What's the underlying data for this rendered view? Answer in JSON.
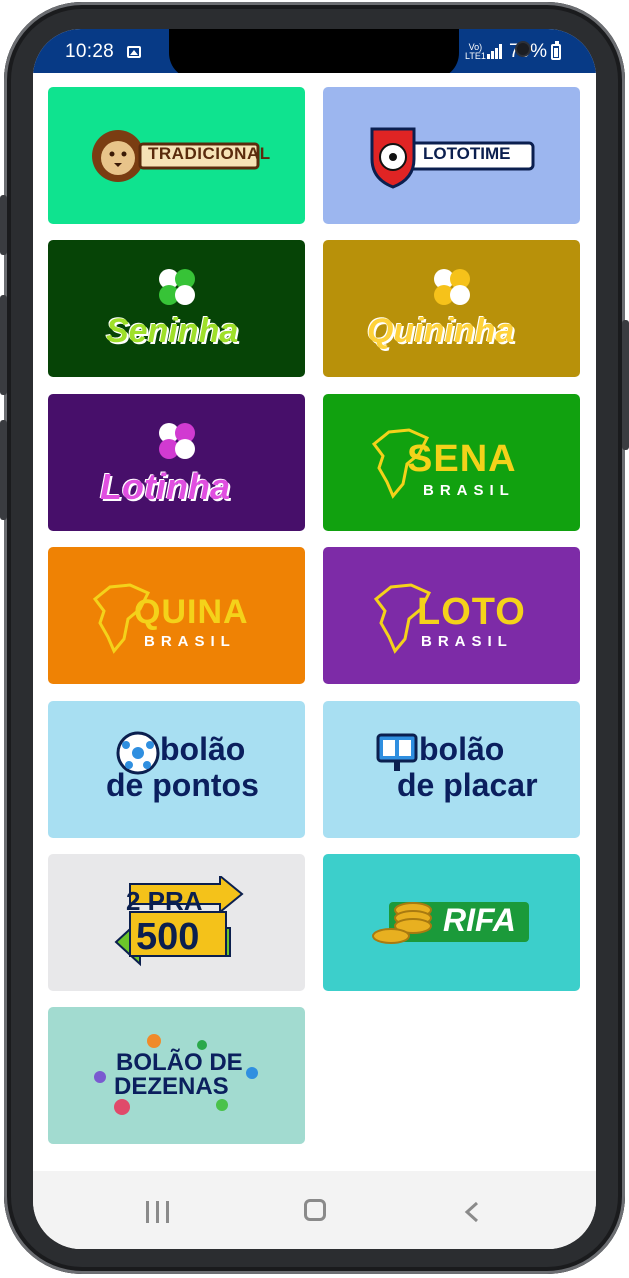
{
  "status_bar": {
    "time": "10:28",
    "network_top": "Vo)",
    "network_bottom": "LTE1",
    "battery_percent": "79%",
    "background": "#073a86"
  },
  "games": [
    {
      "label": "TRADICIONAL",
      "background": "#0fe38f",
      "icon": "lion-icon"
    },
    {
      "label": "LOTOTIME",
      "background": "#9cb6ef",
      "icon": "soccer-shield-icon"
    },
    {
      "label": "Seninha",
      "background": "#064406",
      "icon": "clover-icon"
    },
    {
      "label": "Quininha",
      "background": "#b8910a",
      "icon": "clover-icon"
    },
    {
      "label": "Lotinha",
      "background": "#470f6a",
      "icon": "clover-icon"
    },
    {
      "label": "SENA",
      "sublabel": "BRASIL",
      "background": "#11a10f",
      "icon": "brazil-map-icon"
    },
    {
      "label": "QUINA",
      "sublabel": "BRASIL",
      "background": "#ef8204",
      "icon": "brazil-map-icon"
    },
    {
      "label": "LOTO",
      "sublabel": "BRASIL",
      "background": "#7d2ba7",
      "icon": "brazil-map-icon"
    },
    {
      "label": "bolão",
      "sublabel": "de pontos",
      "background": "#a8dff2",
      "icon": "soccer-ball-icon"
    },
    {
      "label": "bolão",
      "sublabel": "de placar",
      "background": "#a8dff2",
      "icon": "scoreboard-icon"
    },
    {
      "label": "2 PRA",
      "sublabel": "500",
      "background": "#e8e8ea",
      "icon": "arrow-icon"
    },
    {
      "label": "RIFA",
      "background": "#3ccfcb",
      "icon": "coins-icon"
    },
    {
      "label": "BOLÃO DE",
      "sublabel": "DEZENAS",
      "background": "#a2dbd0",
      "icon": "lottery-balls-icon"
    }
  ],
  "nav": {
    "recent": "recent-apps",
    "home": "home",
    "back": "back"
  }
}
